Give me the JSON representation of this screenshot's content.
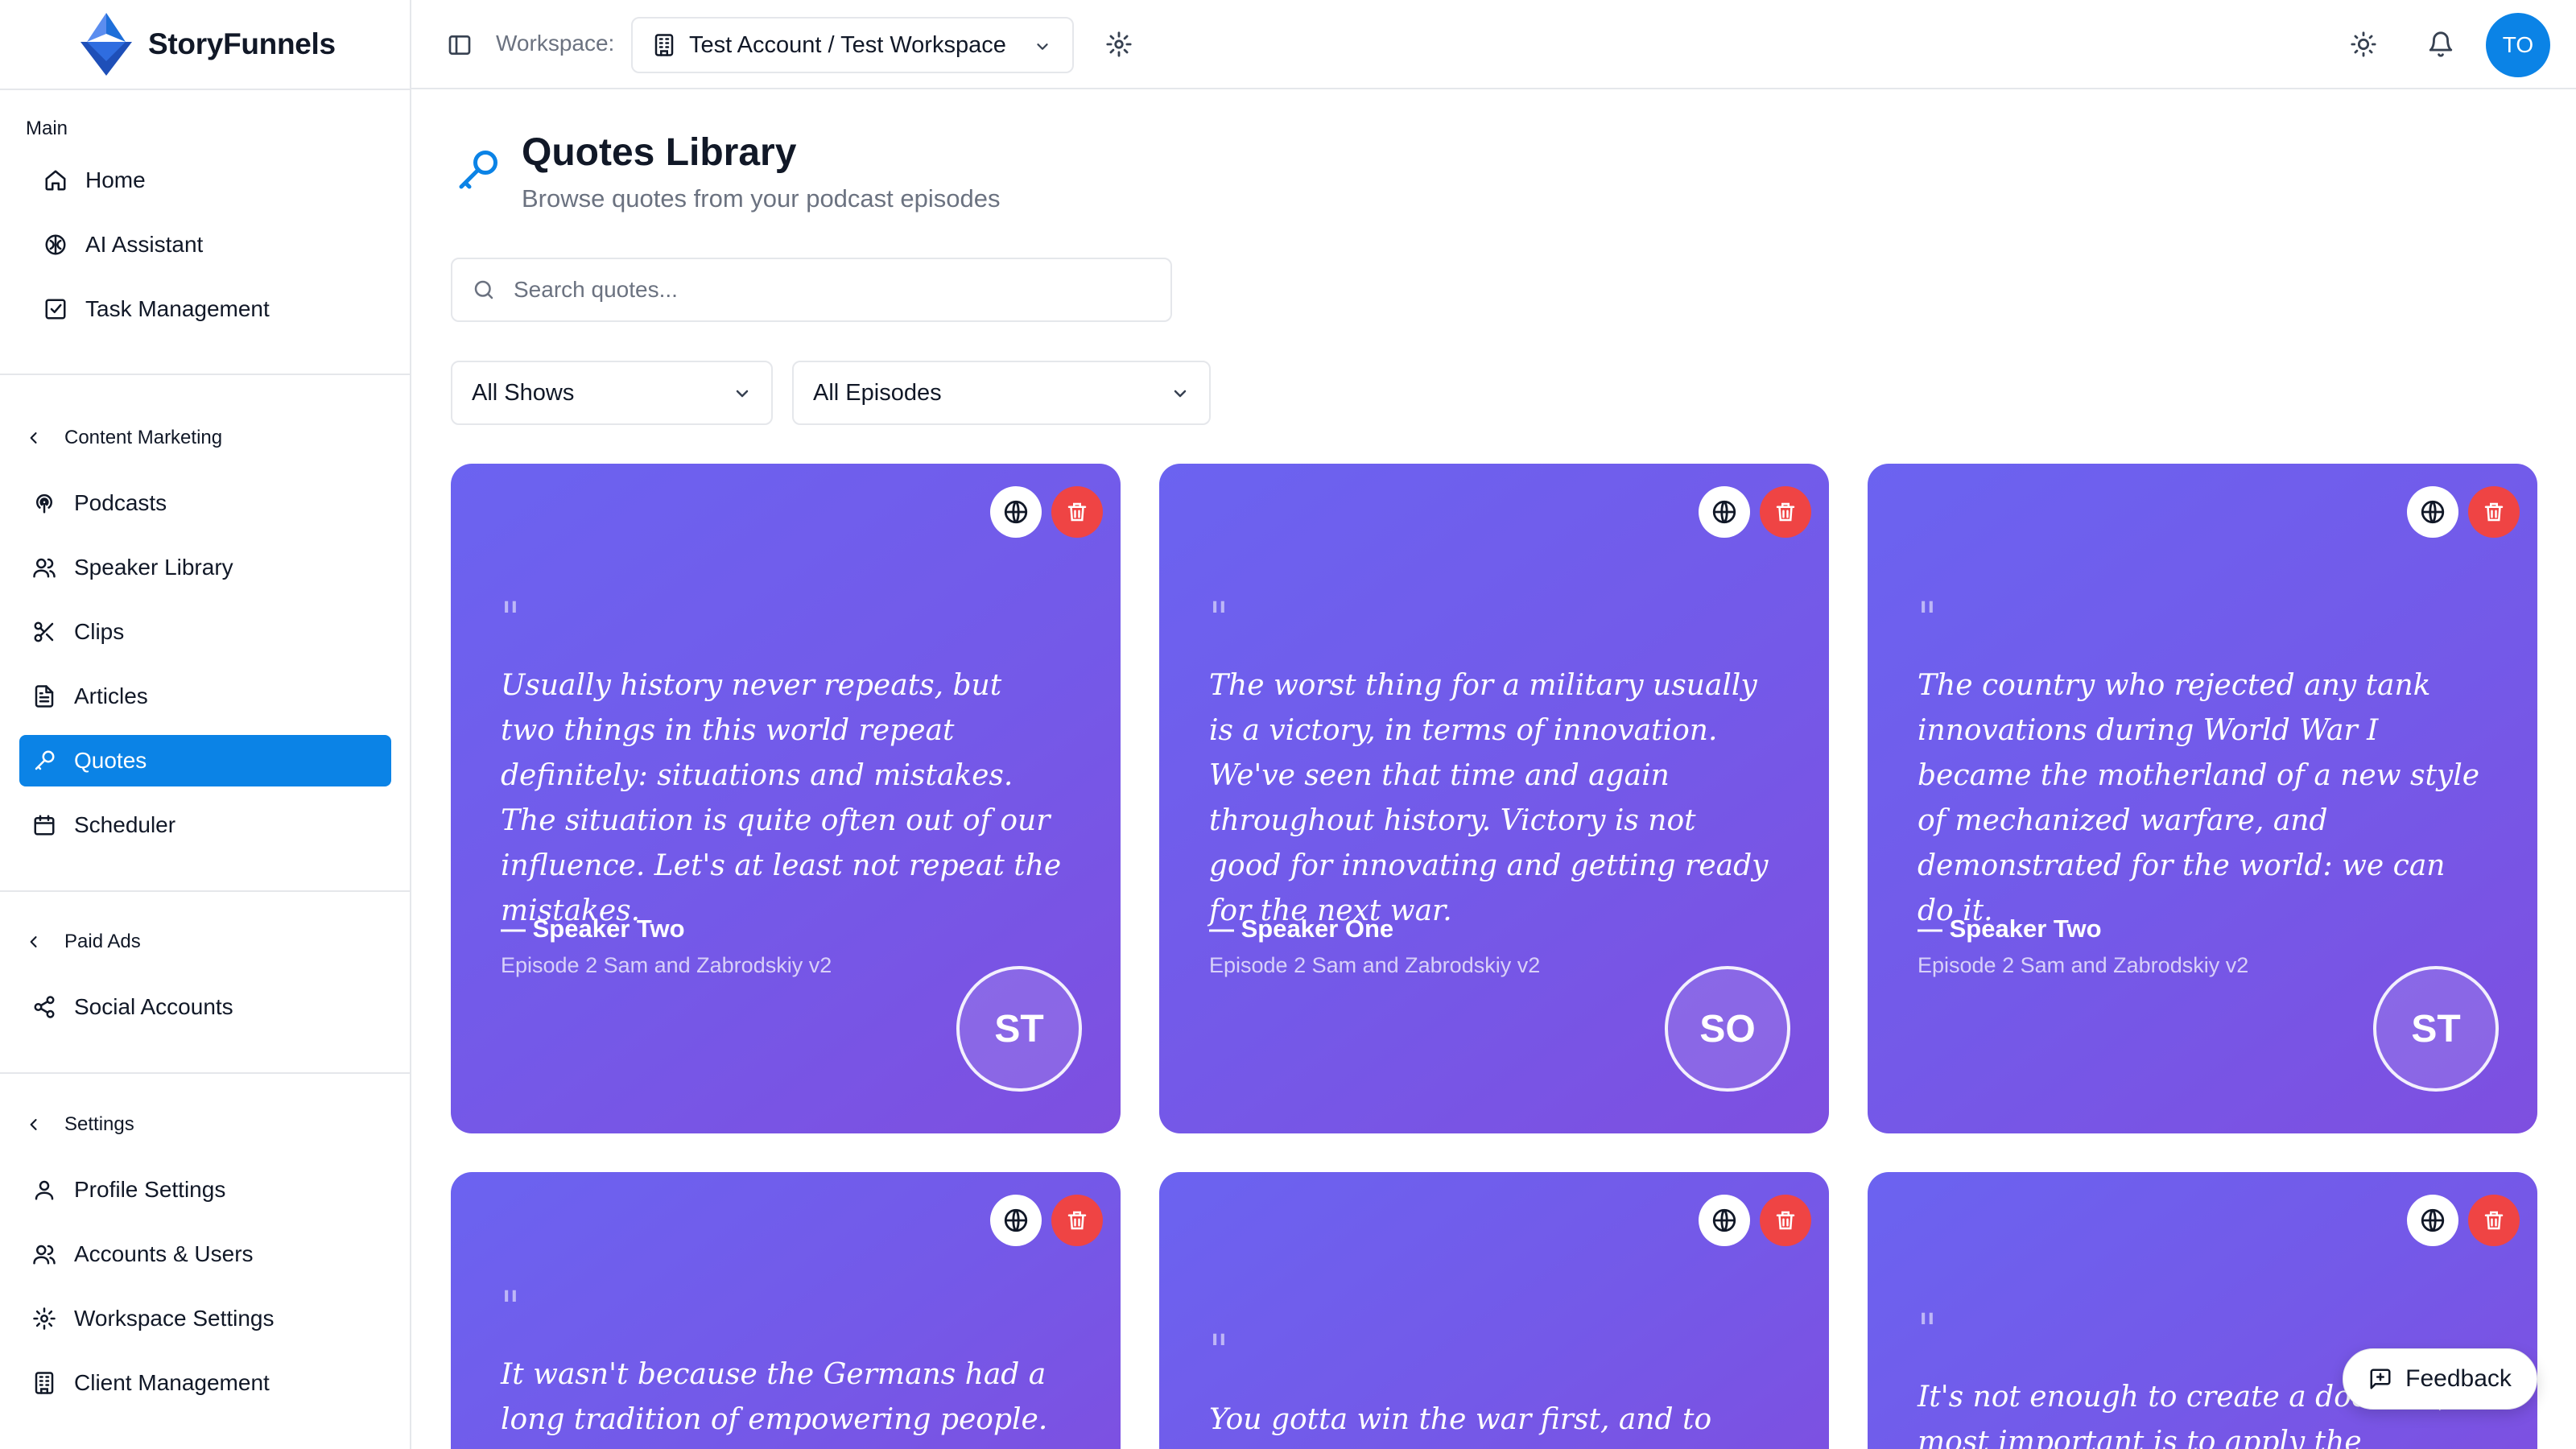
{
  "app": {
    "name": "StoryFunnels",
    "brand_color": "#0b83e6"
  },
  "header": {
    "workspace_label": "Workspace:",
    "workspace_value": "Test Account / Test Workspace",
    "avatar_initials": "TO"
  },
  "sidebar": {
    "main_label": "Main",
    "main_items": [
      {
        "label": "Home",
        "icon": "home-icon"
      },
      {
        "label": "AI Assistant",
        "icon": "brain-icon"
      },
      {
        "label": "Task Management",
        "icon": "checkbox-icon"
      }
    ],
    "content_marketing": {
      "label": "Content Marketing",
      "items": [
        {
          "label": "Podcasts",
          "icon": "podcast-icon"
        },
        {
          "label": "Speaker Library",
          "icon": "users-icon"
        },
        {
          "label": "Clips",
          "icon": "scissors-icon"
        },
        {
          "label": "Articles",
          "icon": "file-text-icon"
        },
        {
          "label": "Quotes",
          "icon": "microphone-icon",
          "active": true
        },
        {
          "label": "Scheduler",
          "icon": "calendar-icon"
        }
      ]
    },
    "paid_ads": {
      "label": "Paid Ads",
      "items": [
        {
          "label": "Social Accounts",
          "icon": "share-icon"
        }
      ]
    },
    "settings": {
      "label": "Settings",
      "items": [
        {
          "label": "Profile Settings",
          "icon": "user-icon"
        },
        {
          "label": "Accounts & Users",
          "icon": "users-icon"
        },
        {
          "label": "Workspace Settings",
          "icon": "gear-icon"
        },
        {
          "label": "Client Management",
          "icon": "building-icon"
        }
      ]
    }
  },
  "page": {
    "title": "Quotes Library",
    "subtitle": "Browse quotes from your podcast episodes",
    "search_placeholder": "Search quotes...",
    "filter_shows": "All Shows",
    "filter_episodes": "All Episodes"
  },
  "quotes": [
    {
      "quote_mark": "\"",
      "text": "Usually history never repeats, but two things in this world repeat definitely: situations and mistakes. The situation is quite often out of our influence. Let's at least not repeat the mistakes.",
      "speaker": "— Speaker Two",
      "episode": "Episode 2 Sam and Zabrodskiy v2",
      "initials": "ST"
    },
    {
      "quote_mark": "\"",
      "text": "The worst thing for a military usually is a victory, in terms of innovation. We've seen that time and again throughout history. Victory is not good for innovating and getting ready for the next war.",
      "speaker": "— Speaker One",
      "episode": "Episode 2 Sam and Zabrodskiy v2",
      "initials": "SO"
    },
    {
      "quote_mark": "\"",
      "text": "The country who rejected any tank innovations during World War I became the motherland of a new style of mechanized warfare, and demonstrated for the world: we can do it.",
      "speaker": "— Speaker Two",
      "episode": "Episode 2 Sam and Zabrodskiy v2",
      "initials": "ST"
    },
    {
      "quote_mark": "\"",
      "text": "It wasn't because the Germans had a long tradition of empowering people. That was",
      "speaker": "",
      "episode": "",
      "initials": ""
    },
    {
      "quote_mark": "\"",
      "text": "You gotta win the war first, and to win",
      "speaker": "",
      "episode": "",
      "initials": ""
    },
    {
      "quote_mark": "\"",
      "text": "It's not enough to create a doctrine, most important is to apply the doctrine. If",
      "speaker": "",
      "episode": "",
      "initials": ""
    }
  ],
  "feedback_label": "Feedback"
}
